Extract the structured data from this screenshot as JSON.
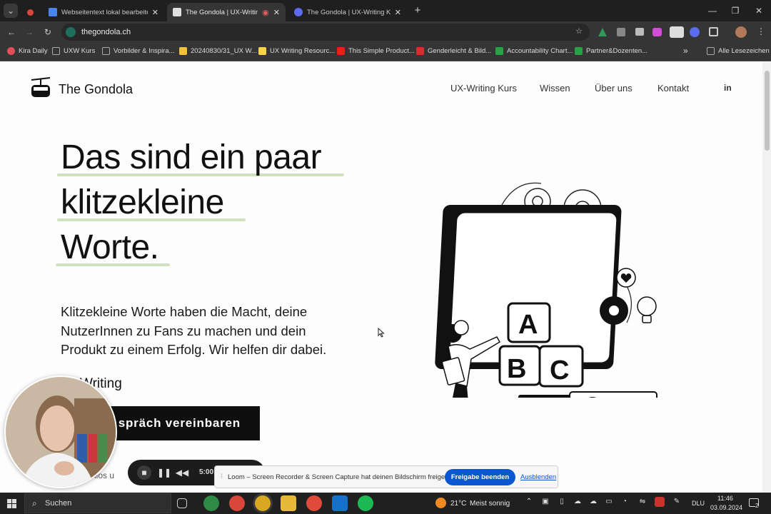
{
  "window": {
    "tabs": [
      {
        "label": "",
        "active": false,
        "favicon_color": "#d9463a"
      },
      {
        "label": "Webseitentext lokal bearbeiten",
        "active": false,
        "favicon_color": "#4a84ee"
      },
      {
        "label": "The Gondola | UX-Writing K",
        "active": true,
        "favicon_color": "#e0e0e0"
      },
      {
        "label": "The Gondola | UX-Writing Kom",
        "active": false,
        "favicon_color": "#5b6cf0"
      }
    ],
    "new_tab": "+",
    "url": "thegondola.ch",
    "bookmarks": [
      {
        "label": "Kira Daily",
        "color": "#e04e5b"
      },
      {
        "label": "UXW Kurs",
        "color": "#aaaaaa"
      },
      {
        "label": "Vorbilder & Inspira...",
        "color": "#aaaaaa"
      },
      {
        "label": "20240830/31_UX W...",
        "color": "#f2c338"
      },
      {
        "label": "UX Writing Resourc...",
        "color": "#f6d347"
      },
      {
        "label": "This Simple Product...",
        "color": "#e62117"
      },
      {
        "label": "Genderleicht & Bild...",
        "color": "#d23030"
      },
      {
        "label": "Accountability Chart...",
        "color": "#27a347"
      },
      {
        "label": "Partner&Dozenten...",
        "color": "#27a347"
      }
    ],
    "bookmarks_more": "»",
    "all_bookmarks": "Alle Lesezeichen"
  },
  "site": {
    "logo_text": "The Gondola",
    "nav": [
      "UX-Writing Kurs",
      "Wissen",
      "Über uns",
      "Kontakt",
      "in"
    ],
    "headline": [
      "Das sind ein paar",
      "klitzekleine",
      "Worte."
    ],
    "subcopy": "Klitzekleine Worte haben die Macht, deine NutzerInnen zu Fans zu machen und dein Produkt zu einem Erfolg. Wir helfen dir dabei.",
    "ux_link": "Writing",
    "cta": "spräch vereinbaren",
    "footnote": "nlos u",
    "tiles": [
      "A",
      "B",
      "C"
    ]
  },
  "loom": {
    "timer": "5:00",
    "share_text": "Loom – Screen Recorder & Screen Capture hat deinen Bildschirm freigegeben.",
    "share_button": "Freigabe beenden",
    "hide_link": "Ausblenden"
  },
  "taskbar": {
    "search_label": "Suchen",
    "weather": "21°C",
    "weather_text": "Meist sonnig",
    "language": "DLU",
    "time": "11:46",
    "date": "03.09.2024",
    "notification_count": "2"
  }
}
